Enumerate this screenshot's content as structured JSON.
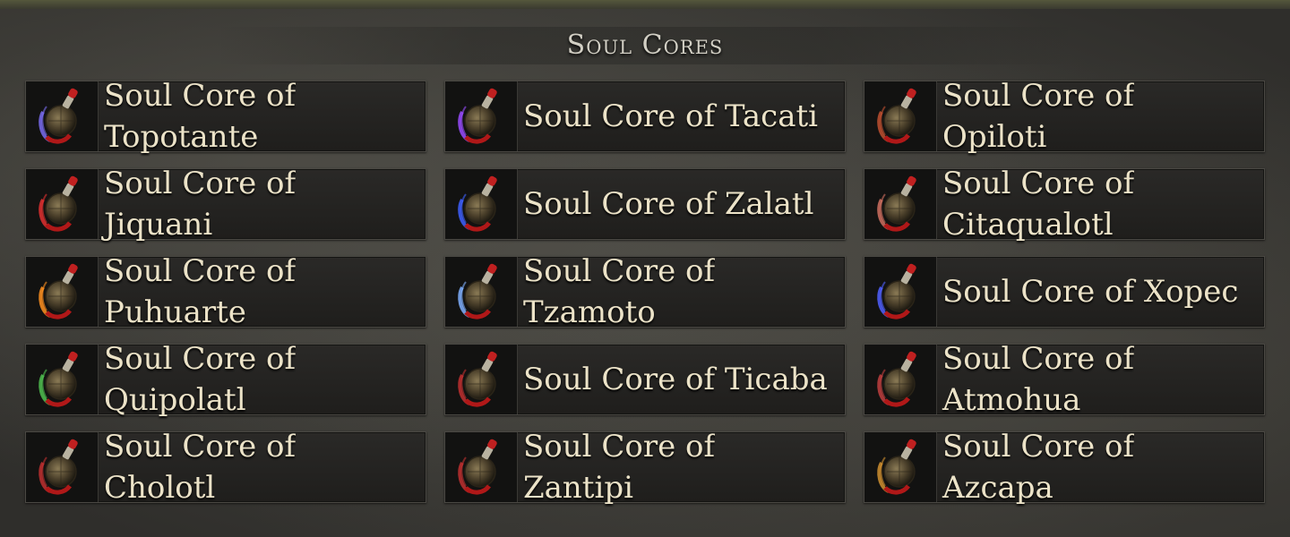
{
  "title": "Soul Cores",
  "items": [
    {
      "label": "Soul Core of\nTopotante",
      "icon": "soul-core-topotante-icon",
      "accent": "#7a6cf0"
    },
    {
      "label": "Soul Core of Tacati",
      "icon": "soul-core-tacati-icon",
      "accent": "#9a4cff"
    },
    {
      "label": "Soul Core of\nOpiloti",
      "icon": "soul-core-opiloti-icon",
      "accent": "#c05030"
    },
    {
      "label": "Soul Core of\nJiquani",
      "icon": "soul-core-jiquani-icon",
      "accent": "#e03030"
    },
    {
      "label": "Soul Core of Zalatl",
      "icon": "soul-core-zalatl-icon",
      "accent": "#4060ff"
    },
    {
      "label": "Soul Core of\nCitaqualotl",
      "icon": "soul-core-citaqualotl-icon",
      "accent": "#d07060"
    },
    {
      "label": "Soul Core of\nPuhuarte",
      "icon": "soul-core-puhuarte-icon",
      "accent": "#ff9020"
    },
    {
      "label": "Soul Core of\nTzamoto",
      "icon": "soul-core-tzamoto-icon",
      "accent": "#80b0ff"
    },
    {
      "label": "Soul Core of Xopec",
      "icon": "soul-core-xopec-icon",
      "accent": "#5060ff"
    },
    {
      "label": "Soul Core of\nQuipolatl",
      "icon": "soul-core-quipolatl-icon",
      "accent": "#50c050"
    },
    {
      "label": "Soul Core of Ticaba",
      "icon": "soul-core-ticaba-icon",
      "accent": "#c03030"
    },
    {
      "label": "Soul Core of\nAtmohua",
      "icon": "soul-core-atmohua-icon",
      "accent": "#c04040"
    },
    {
      "label": "Soul Core of\nCholotl",
      "icon": "soul-core-cholotl-icon",
      "accent": "#c03030"
    },
    {
      "label": "Soul Core of\nZantipi",
      "icon": "soul-core-zantipi-icon",
      "accent": "#c03030"
    },
    {
      "label": "Soul Core of\nAzcapa",
      "icon": "soul-core-azcapa-icon",
      "accent": "#d09030"
    }
  ]
}
